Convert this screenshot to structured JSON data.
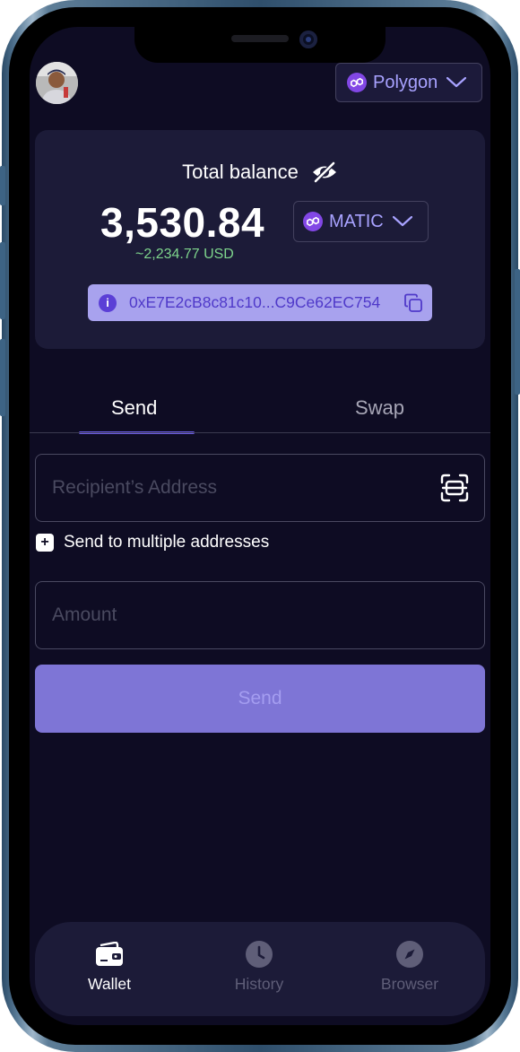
{
  "header": {
    "network_label": "Polygon",
    "avatar_alt": ""
  },
  "balance": {
    "total_label": "Total balance",
    "amount": "3,530.84",
    "usd_value": "~2,234.77 USD",
    "token_label": "MATIC",
    "wallet_address": "0xE7E2cB8c81c10...C9Ce62EC754"
  },
  "tabs": [
    {
      "label": "Send",
      "active": true
    },
    {
      "label": "Swap",
      "active": false
    }
  ],
  "form": {
    "recipient_placeholder": "Recipient’s Address",
    "multi_label": "Send to multiple addresses",
    "amount_placeholder": "Amount",
    "send_label": "Send"
  },
  "nav": [
    {
      "label": "Wallet",
      "icon": "wallet-icon",
      "active": true
    },
    {
      "label": "History",
      "icon": "clock-icon",
      "active": false
    },
    {
      "label": "Browser",
      "icon": "compass-icon",
      "active": false
    }
  ],
  "colors": {
    "background": "#0e0c23",
    "card": "#1c1b38",
    "accent": "#6b5ce6",
    "button": "#7e75d6",
    "usd_green": "#7ed58c",
    "polygon_purple": "#8247e5"
  }
}
